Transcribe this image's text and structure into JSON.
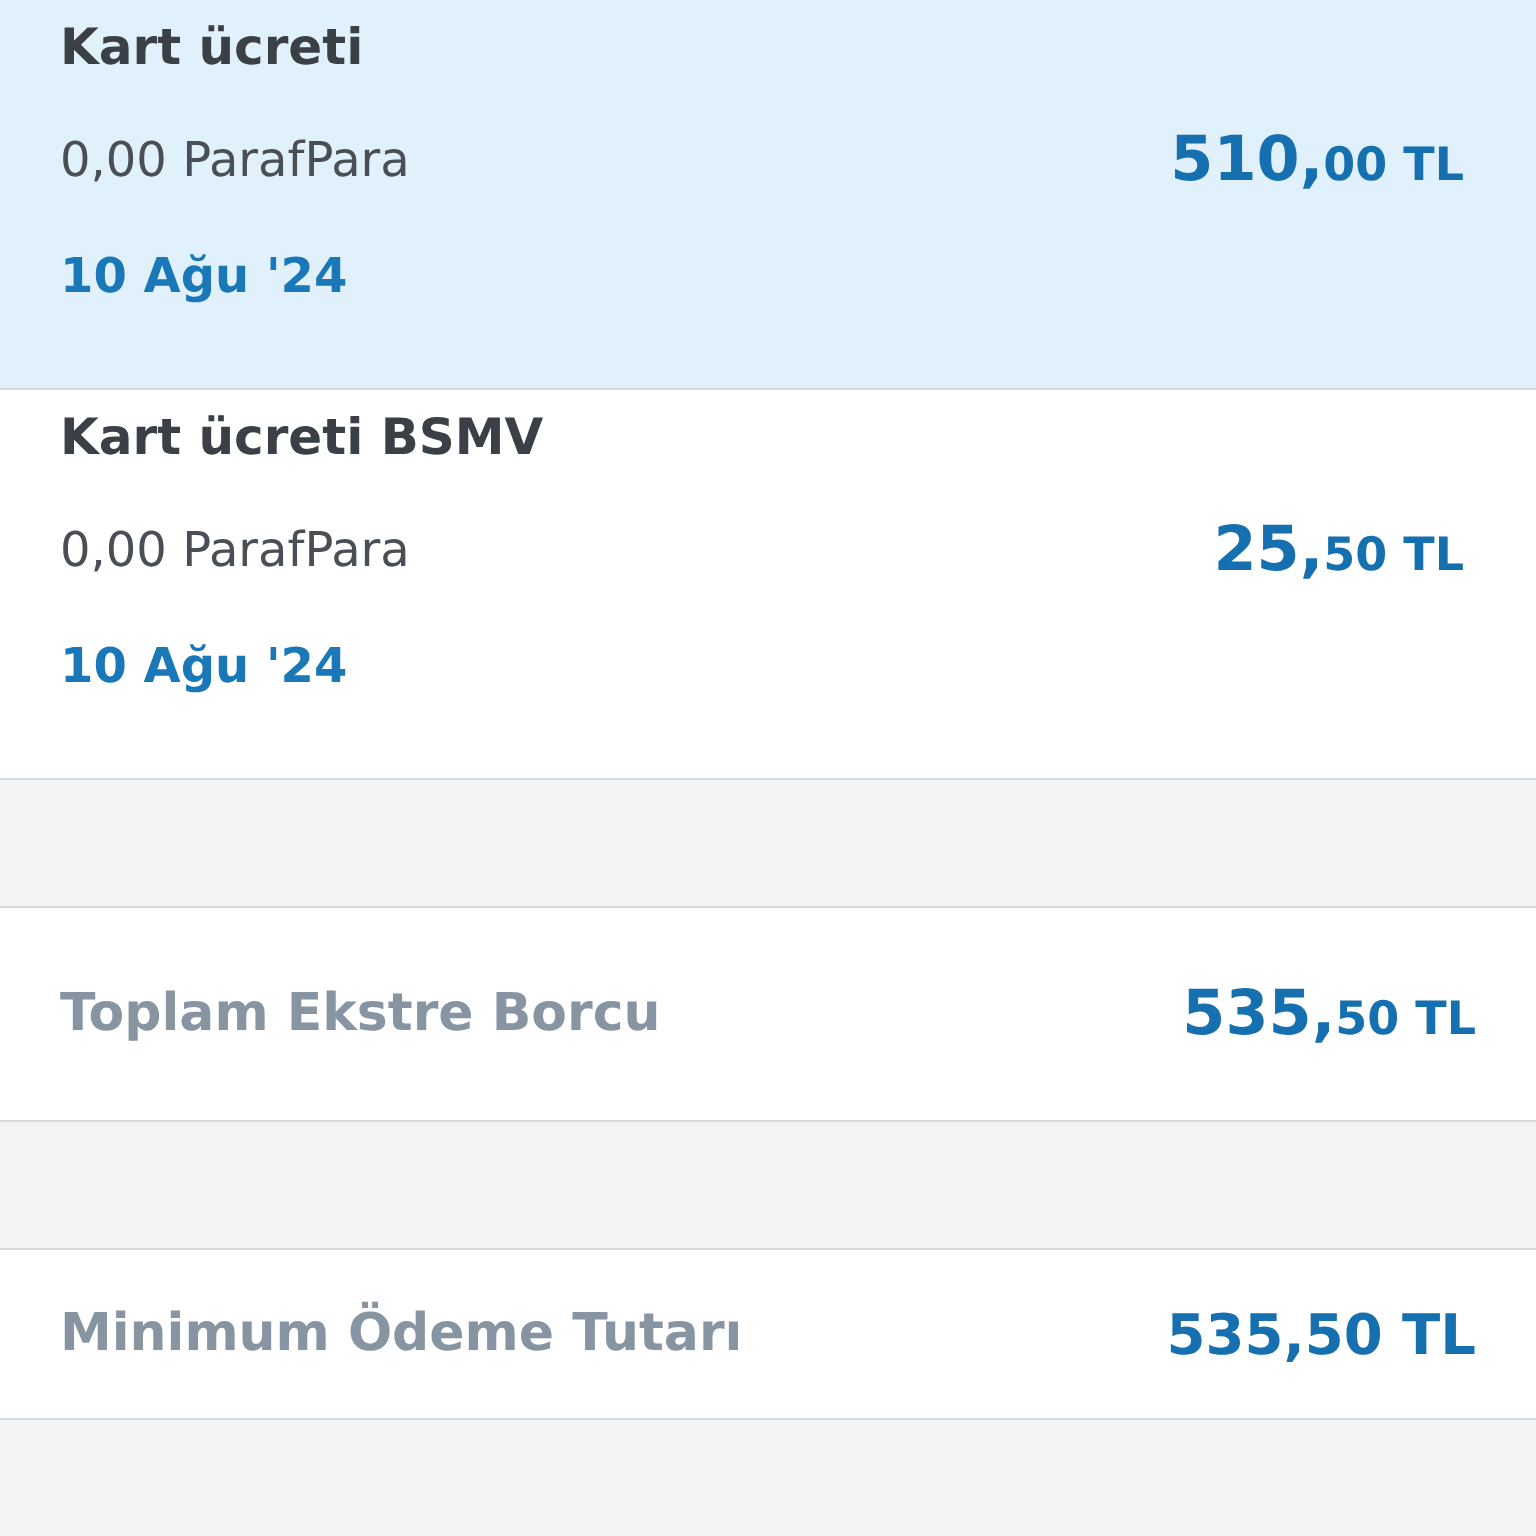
{
  "transactions": [
    {
      "title": "Kart ücreti",
      "points": "0,00 ParafPara",
      "date": "10 Ağu '24",
      "amount_main": "510,",
      "amount_small": "00 TL",
      "selected": true
    },
    {
      "title": "Kart ücreti BSMV",
      "points": "0,00 ParafPara",
      "date": "10 Ağu '24",
      "amount_main": "25,",
      "amount_small": "50 TL",
      "selected": false
    }
  ],
  "summary": [
    {
      "kind": "split",
      "label": "Toplam Ekstre Borcu",
      "amount_main": "535,",
      "amount_small": "50 TL"
    },
    {
      "kind": "plain",
      "label": "Minimum Ödeme Tutarı",
      "amount": "535,50 TL"
    }
  ]
}
